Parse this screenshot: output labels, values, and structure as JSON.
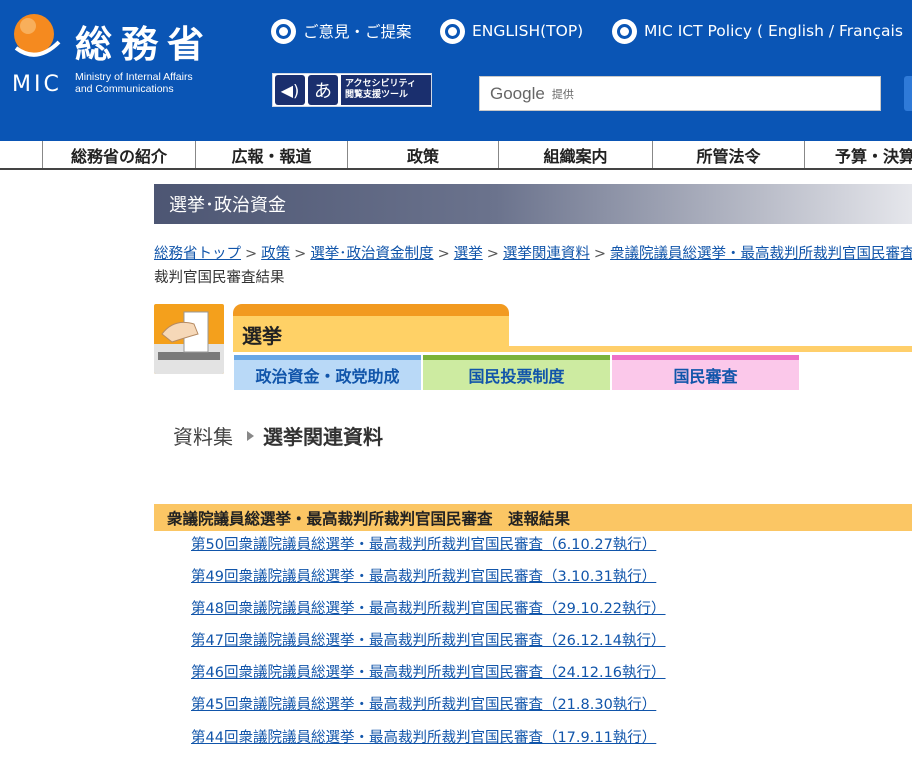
{
  "header": {
    "logo_kanji": "総務省",
    "logo_mic": "MIC",
    "logo_english_1": "Ministry of Internal Affairs",
    "logo_english_2": "and Communications",
    "links": [
      {
        "label": "ご意見・ご提案"
      },
      {
        "label": "ENGLISH(TOP)"
      },
      {
        "label": "MIC ICT Policy ( English / Français"
      }
    ],
    "accessibility_text_1": "アクセシビリティ",
    "accessibility_text_2": "閲覧支援ツール",
    "search_brand": "Google",
    "search_brand_sub": "提供"
  },
  "global_nav": [
    {
      "label": "総務省の紹介"
    },
    {
      "label": "広報・報道"
    },
    {
      "label": "政策"
    },
    {
      "label": "組織案内"
    },
    {
      "label": "所管法令"
    },
    {
      "label": "予算・決算"
    }
  ],
  "section_title": "選挙･政治資金",
  "breadcrumb": {
    "links": [
      "総務省トップ",
      "政策",
      "選挙･政治資金制度",
      "選挙",
      "選挙関連資料",
      "衆議院議員総選挙・最高裁判所裁判官国民審査"
    ],
    "current": "裁判官国民審査結果",
    "separator": ">"
  },
  "election_header": {
    "tab_label": "選挙",
    "subtabs": [
      {
        "label": "政治資金・政党助成",
        "bg": "#b9d9f7",
        "top": "#6aa8e6"
      },
      {
        "label": "国民投票制度",
        "bg": "#cdeba1",
        "top": "#7cb33a"
      },
      {
        "label": "国民審査",
        "bg": "#fbc8ea",
        "top": "#ee70c8"
      }
    ]
  },
  "page_title": {
    "prefix": "資料集",
    "main": "選挙関連資料"
  },
  "results": {
    "heading": "衆議院議員総選挙・最高裁判所裁判官国民審査　速報結果",
    "items": [
      {
        "label": "第50回衆議院議員総選挙・最高裁判所裁判官国民審査（6.10.27執行）"
      },
      {
        "label": "第49回衆議院議員総選挙・最高裁判所裁判官国民審査（3.10.31執行）"
      },
      {
        "label": "第48回衆議院議員総選挙・最高裁判所裁判官国民審査（29.10.22執行）"
      },
      {
        "label": "第47回衆議院議員総選挙・最高裁判所裁判官国民審査（26.12.14執行）"
      },
      {
        "label": "第46回衆議院議員総選挙・最高裁判所裁判官国民審査（24.12.16執行）"
      },
      {
        "label": "第45回衆議院議員総選挙・最高裁判所裁判官国民審査（21.8.30執行）"
      },
      {
        "label": "第44回衆議院議員総選挙・最高裁判所裁判官国民審査（17.9.11執行）"
      }
    ]
  },
  "colors": {
    "header_blue": "#0a55b5",
    "link_blue": "#1155aa",
    "election_orange": "#f29a20",
    "election_yellow": "#ffd166",
    "list_heading_bg": "#fbc664"
  }
}
